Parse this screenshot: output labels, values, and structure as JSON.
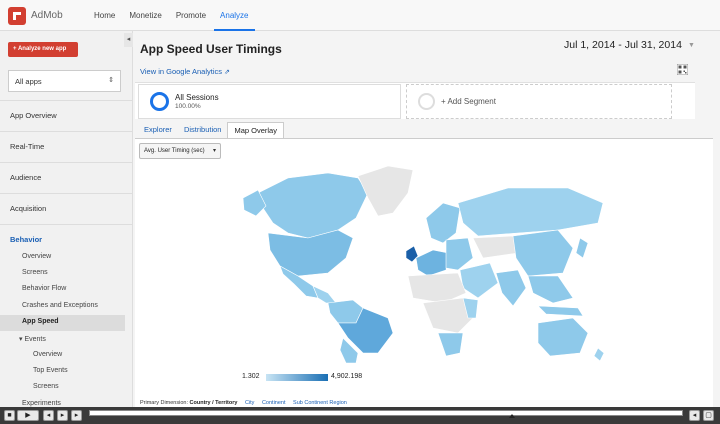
{
  "app": {
    "brand": "AdMob"
  },
  "topnav": [
    {
      "label": "Home",
      "active": false
    },
    {
      "label": "Monetize",
      "active": false
    },
    {
      "label": "Promote",
      "active": false
    },
    {
      "label": "Analyze",
      "active": true
    }
  ],
  "sidebar": {
    "analyze_button": "+ Analyze new app",
    "apps_select": "All apps",
    "items": [
      "App Overview",
      "Real-Time",
      "Audience",
      "Acquisition"
    ],
    "behavior": "Behavior",
    "behavior_children": [
      "Overview",
      "Screens",
      "Behavior Flow",
      "Crashes and Exceptions",
      "App Speed",
      "Events"
    ],
    "events_children": [
      "Overview",
      "Top Events",
      "Screens"
    ],
    "more": "Experiments"
  },
  "report": {
    "title": "App Speed User Timings",
    "date_range": "Jul 1, 2014 - Jul 31, 2014",
    "ga_link": "View in Google Analytics"
  },
  "segments": {
    "primary_name": "All Sessions",
    "primary_pct": "100.00%",
    "add_label": "+ Add Segment"
  },
  "tabs": [
    {
      "label": "Explorer",
      "active": false
    },
    {
      "label": "Distribution",
      "active": false
    },
    {
      "label": "Map Overlay",
      "active": true
    }
  ],
  "metric_select": "Avg. User Timing (sec)",
  "legend": {
    "min": "1.302",
    "max": "4,902.198"
  },
  "primary_dimension": {
    "label": "Primary Dimension:",
    "selected": "Country / Territory",
    "options": [
      "City",
      "Continent",
      "Sub Continent Region"
    ]
  },
  "colors": {
    "accent": "#1a73e8",
    "button_red": "#d23f31",
    "map_light": "#8ec9ea",
    "map_dark": "#1a5fa8",
    "map_none": "#e6e6e6"
  }
}
